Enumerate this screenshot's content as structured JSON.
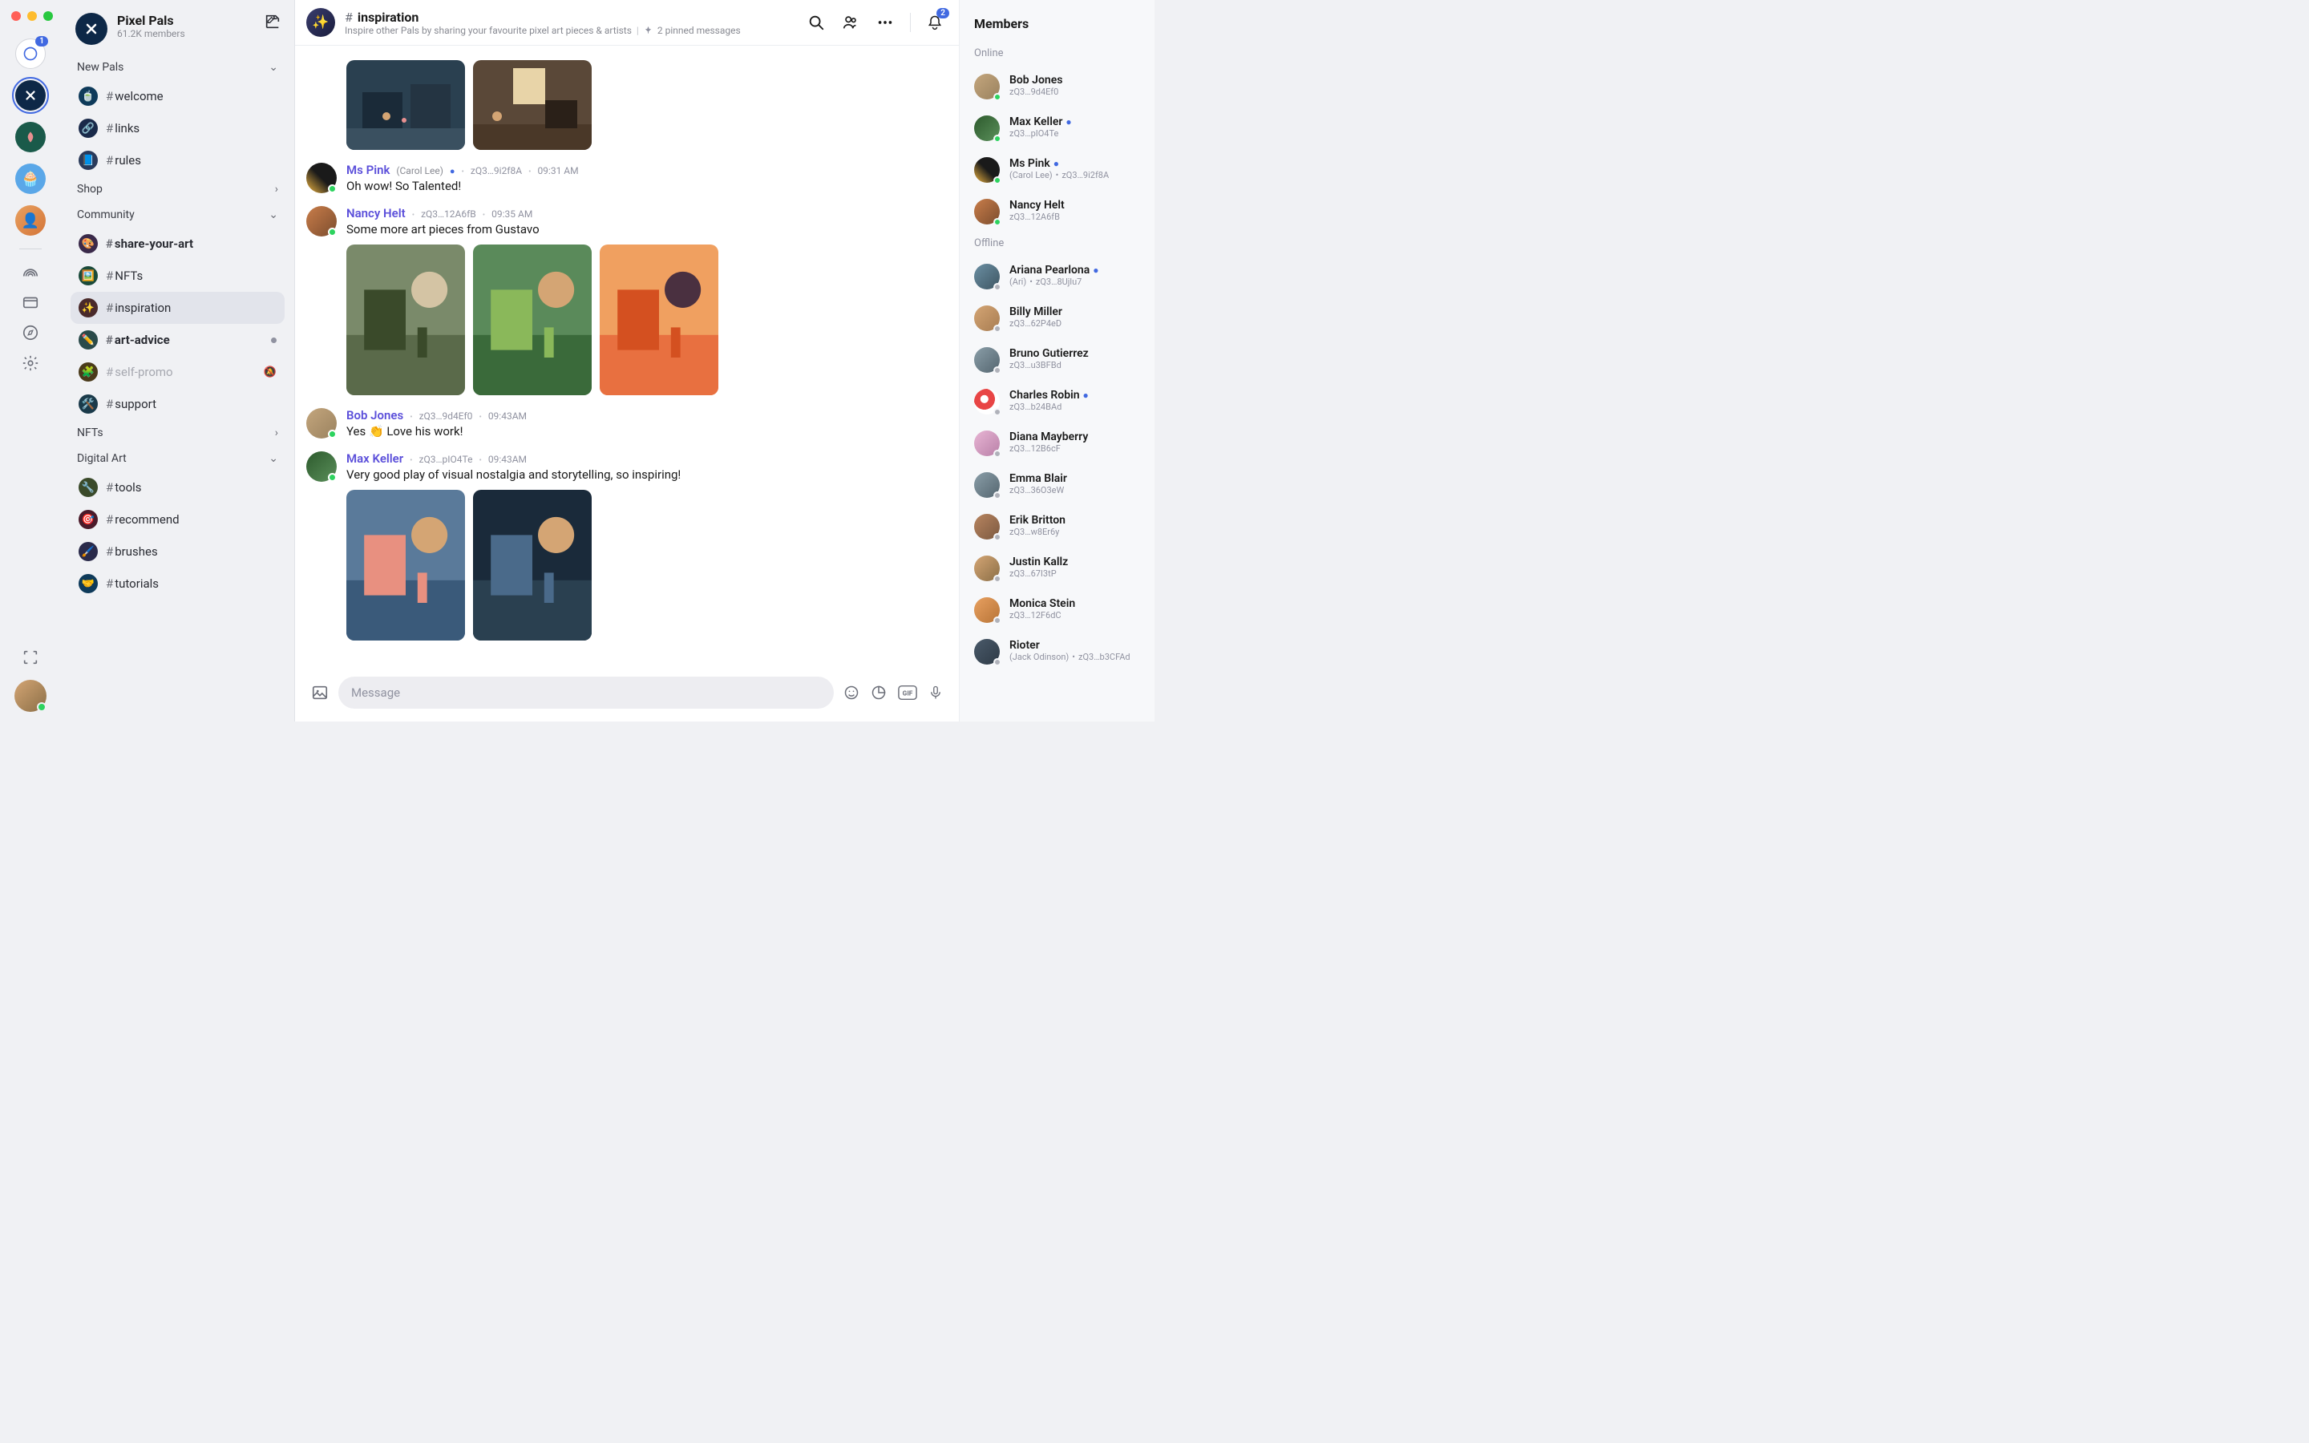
{
  "rail": {
    "servers": [
      {
        "id": "direct",
        "badge": "1",
        "name": "direct-messages"
      },
      {
        "id": "pixelpals",
        "name": "pixelpals-server",
        "active": true
      },
      {
        "id": "s3",
        "name": "server-3"
      },
      {
        "id": "s4",
        "name": "server-4"
      },
      {
        "id": "s5",
        "name": "server-5"
      }
    ]
  },
  "server": {
    "title": "Pixel Pals",
    "subtitle": "61.2K members"
  },
  "groups": [
    {
      "label": "New Pals",
      "open": true
    },
    {
      "label": "Shop",
      "open": false
    },
    {
      "label": "Community",
      "open": true
    },
    {
      "label": "NFTs",
      "open": false
    },
    {
      "label": "Digital Art",
      "open": true
    }
  ],
  "channels": {
    "welcome": {
      "label": "welcome",
      "emoji": "🍵"
    },
    "links": {
      "label": "links",
      "emoji": "🔗"
    },
    "rules": {
      "label": "rules",
      "emoji": "📘"
    },
    "share": {
      "label": "share-your-art",
      "emoji": "🎨",
      "bold": true
    },
    "nfts": {
      "label": "NFTs",
      "emoji": "🖼️"
    },
    "inspiration": {
      "label": "inspiration",
      "emoji": "✨",
      "active": true
    },
    "artadvice": {
      "label": "art-advice",
      "emoji": "✏️",
      "bold": true,
      "unread": true
    },
    "selfpromo": {
      "label": "self-promo",
      "emoji": "🧩",
      "muted": true
    },
    "support": {
      "label": "support",
      "emoji": "🛠️"
    },
    "tools": {
      "label": "tools",
      "emoji": "🔧"
    },
    "recommend": {
      "label": "recommend",
      "emoji": "🎯"
    },
    "brushes": {
      "label": "brushes",
      "emoji": "🖌️"
    },
    "tutorials": {
      "label": "tutorials",
      "emoji": "🤝"
    }
  },
  "chat": {
    "title": "inspiration",
    "desc": "Inspire other Pals by sharing your favourite pixel art pieces & artists",
    "pinned": "2 pinned messages",
    "bell_count": "2",
    "input_placeholder": "Message"
  },
  "messages": [
    {
      "name": "Ms Pink",
      "alias": "(Carol Lee)",
      "verified": true,
      "hash": "zQ3…9i2f8A",
      "time": "09:31 AM",
      "text": "Oh wow! So Talented!",
      "avatar": "av-ms"
    },
    {
      "name": "Nancy Helt",
      "hash": "zQ3…12A6fB",
      "time": "09:35 AM",
      "text": "Some more art pieces from Gustavo",
      "avatar": "av-nh",
      "images": 3
    },
    {
      "name": "Bob Jones",
      "hash": "zQ3…9d4Ef0",
      "time": "09:43AM",
      "text": "Yes 👏 Love his work!",
      "avatar": "av-bj"
    },
    {
      "name": "Max Keller",
      "hash": "zQ3…pIO4Te",
      "time": "09:43AM",
      "text": "Very good play of visual nostalgia and storytelling, so inspiring!",
      "avatar": "av-mk",
      "images": 2
    }
  ],
  "members": {
    "title": "Members",
    "online_label": "Online",
    "offline_label": "Offline",
    "online": [
      {
        "name": "Bob Jones",
        "sub": "zQ3…9d4Ef0",
        "av": "av-bj"
      },
      {
        "name": "Max Keller",
        "sub": "zQ3…pIO4Te",
        "verified": true,
        "av": "av-mk"
      },
      {
        "name": "Ms Pink",
        "alias": "(Carol Lee)",
        "sub": "zQ3…9i2f8A",
        "verified": true,
        "av": "av-ms"
      },
      {
        "name": "Nancy Helt",
        "sub": "zQ3…12A6fB",
        "av": "av-nh"
      }
    ],
    "offline": [
      {
        "name": "Ariana Pearlona",
        "alias": "(Ari)",
        "sub": "zQ3…8Ujlu7",
        "verified": true,
        "av": "av-5"
      },
      {
        "name": "Billy Miller",
        "sub": "zQ3…62P4eD",
        "av": "av-6"
      },
      {
        "name": "Bruno Gutierrez",
        "sub": "zQ3…u3BFBd",
        "av": "av-9"
      },
      {
        "name": "Charles Robin",
        "sub": "zQ3…b24BAd",
        "verified": true,
        "av": "av-7"
      },
      {
        "name": "Diana Mayberry",
        "sub": "zQ3…12B6cF",
        "av": "av-8"
      },
      {
        "name": "Emma Blair",
        "sub": "zQ3…36O3eW",
        "av": "av-9"
      },
      {
        "name": "Erik Britton",
        "sub": "zQ3…w8Er6y",
        "av": "av-10"
      },
      {
        "name": "Justin Kallz",
        "sub": "zQ3…67I3tP",
        "av": "av-11"
      },
      {
        "name": "Monica Stein",
        "sub": "zQ3…12F6dC",
        "av": "av-12"
      },
      {
        "name": "Rioter",
        "alias": "(Jack Odinson)",
        "sub": "zQ3…b3CFAd",
        "av": "av-13"
      }
    ]
  }
}
